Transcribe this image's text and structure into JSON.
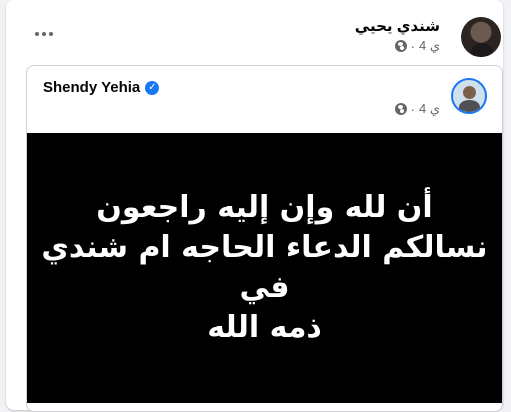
{
  "post": {
    "author_name": "شندي يحيي",
    "time": "4 ي",
    "more_icon": "more-horizontal-icon",
    "privacy_icon": "globe-icon"
  },
  "shared_post": {
    "author_name": "Shendy Yehia",
    "verified_icon": "verified-badge-icon",
    "time": "4 ي",
    "privacy_icon": "globe-icon",
    "image_text_lines": [
      "أن لله وإن إليه راجعون",
      "نسالكم الدعاء الحاجه ام شندي في",
      "ذمه الله"
    ]
  },
  "colors": {
    "background": "#f0f2f5",
    "card": "#ffffff",
    "image_background": "#000000",
    "verified": "#1877f2",
    "secondary_text": "#65676b"
  }
}
